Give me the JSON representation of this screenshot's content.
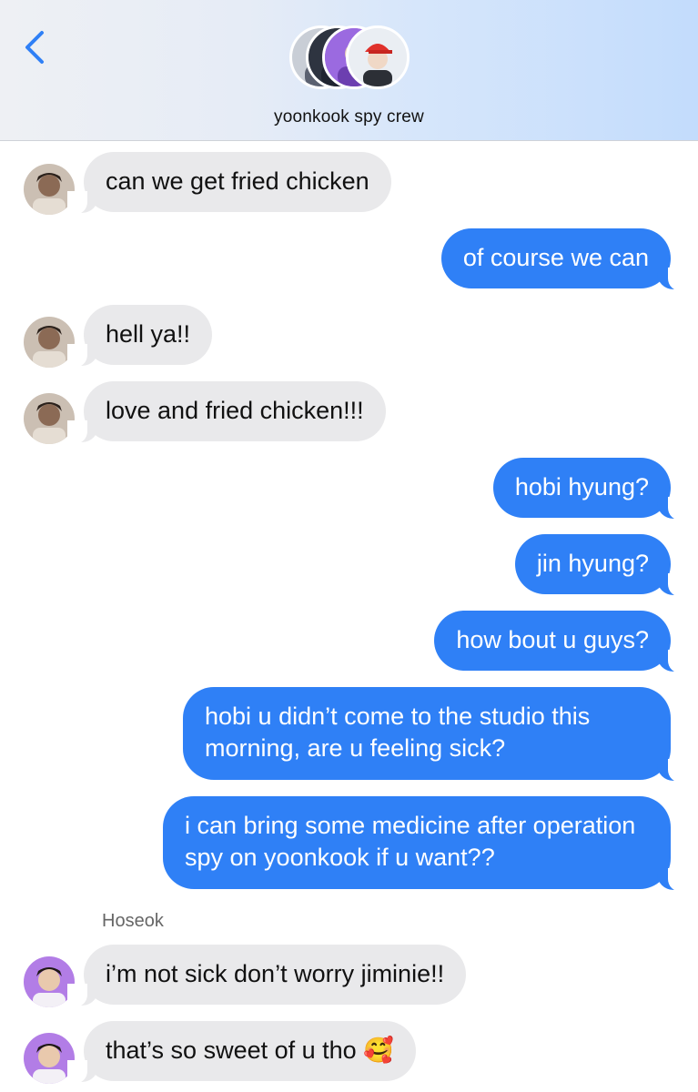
{
  "header": {
    "group_name": "yoonkook spy crew",
    "back_icon": "chevron-left-icon",
    "accent_color": "#2f80f6"
  },
  "messages": [
    {
      "dir": "in",
      "text": "can we get fried chicken"
    },
    {
      "dir": "out",
      "text": "of course we can"
    },
    {
      "dir": "in",
      "text": "hell ya!!"
    },
    {
      "dir": "in",
      "text": "love and fried chicken!!!"
    },
    {
      "dir": "out",
      "text": "hobi hyung?"
    },
    {
      "dir": "out",
      "text": "jin hyung?"
    },
    {
      "dir": "out",
      "text": "how bout u guys?"
    },
    {
      "dir": "out",
      "text": "hobi u didn’t come to the studio this morning, are u feeling sick?"
    },
    {
      "dir": "out",
      "text": "i can bring some medicine after operation spy on yoonkook if u want??"
    },
    {
      "dir": "in",
      "sender": "Hoseok",
      "text": "i’m not sick don’t worry jiminie!!"
    },
    {
      "dir": "in",
      "text": "that’s so sweet of u tho 🥰"
    }
  ],
  "colors": {
    "incoming_bubble": "#e9e9eb",
    "outgoing_bubble": "#2f80f6"
  }
}
